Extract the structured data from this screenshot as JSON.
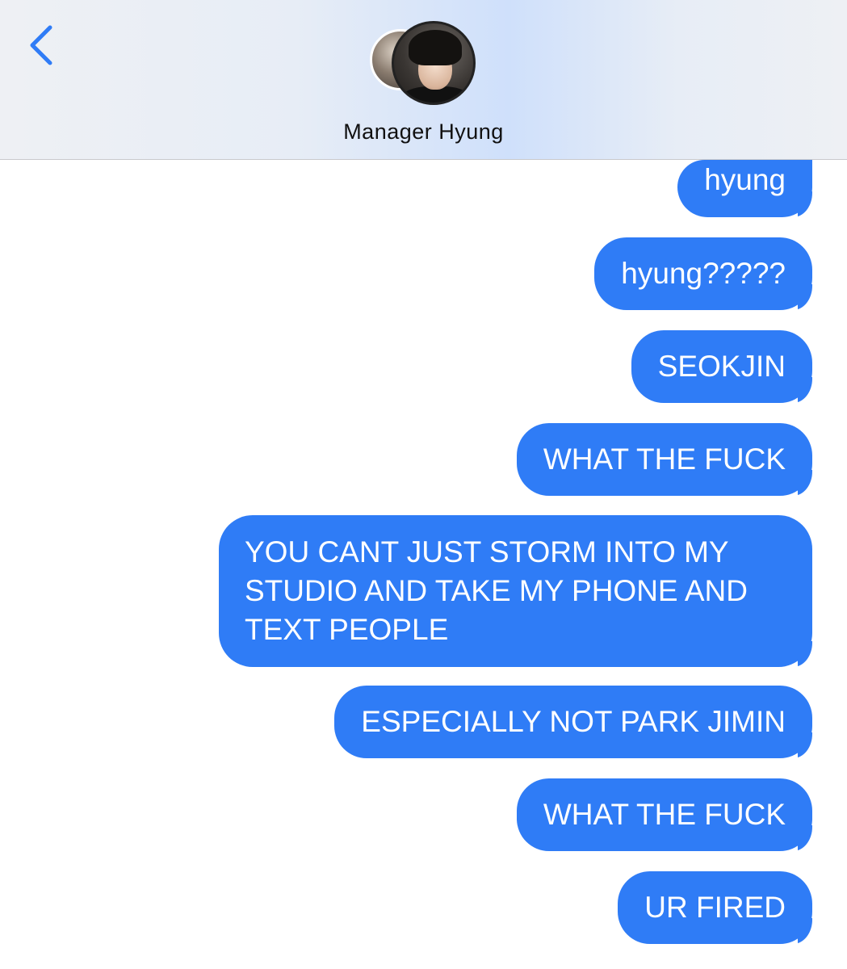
{
  "header": {
    "back_icon": "chevron-left-icon",
    "contact_name": "Manager Hyung",
    "accent_color": "#2f7cf6"
  },
  "messages": [
    {
      "text": "hyung"
    },
    {
      "text": "hyung?????"
    },
    {
      "text": "SEOKJIN"
    },
    {
      "text": "WHAT THE FUCK"
    },
    {
      "lines": [
        "YOU CANT JUST STORM INTO MY",
        "STUDIO AND TAKE MY PHONE AND",
        "TEXT PEOPLE"
      ]
    },
    {
      "text": "ESPECIALLY NOT PARK JIMIN"
    },
    {
      "text": "WHAT THE FUCK"
    },
    {
      "text": "UR FIRED"
    }
  ]
}
